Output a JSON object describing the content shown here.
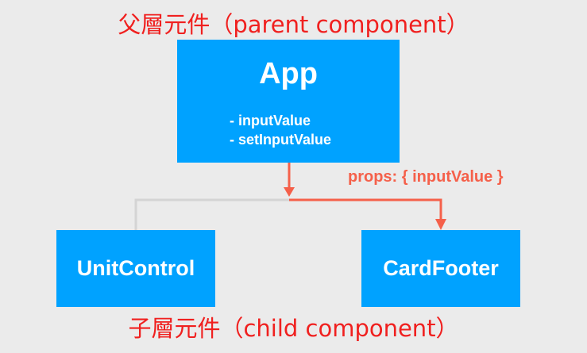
{
  "parent_label": "父層元件（parent component）",
  "child_label": "子層元件（child component）",
  "app": {
    "name": "App",
    "fields": [
      "- inputValue",
      "- setInputValue"
    ]
  },
  "children": [
    {
      "name": "UnitControl"
    },
    {
      "name": "CardFooter"
    }
  ],
  "props_label": "props: { inputValue }",
  "colors": {
    "box": "#00a2ff",
    "arrow": "#f5604a",
    "line": "#d4d4d4",
    "heading": "#f0201f"
  }
}
